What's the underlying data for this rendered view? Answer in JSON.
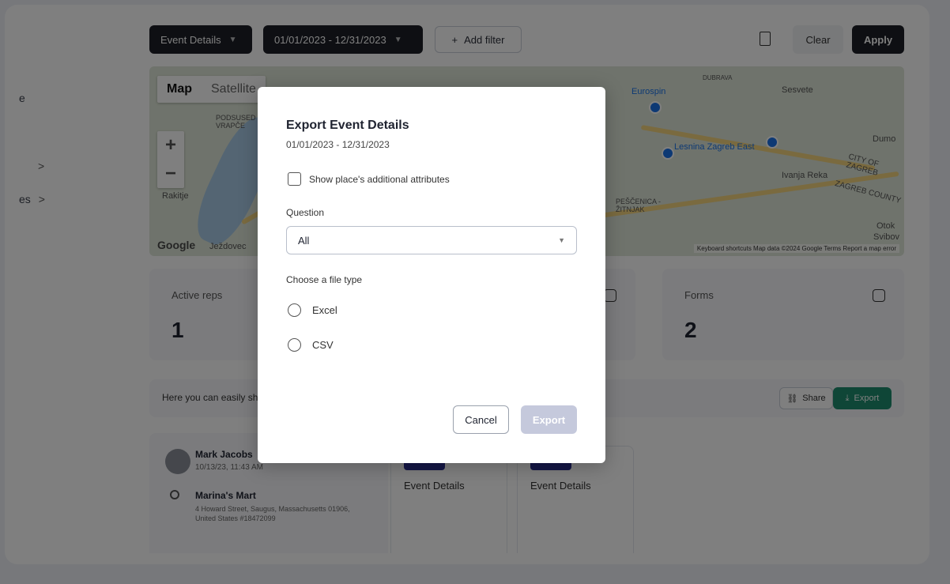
{
  "nav": {
    "items": [
      {
        "label": "e",
        "chevron": ""
      },
      {
        "label": "",
        "chevron": ""
      },
      {
        "label": "",
        "chevron": ">"
      },
      {
        "label": "es",
        "chevron": ">"
      }
    ]
  },
  "topbar": {
    "report_select": "Event Details",
    "date_range": "01/01/2023 - 12/31/2023",
    "add_filter": "Add filter",
    "clear": "Clear",
    "apply": "Apply"
  },
  "map": {
    "tab_map": "Map",
    "tab_satellite": "Satellite",
    "zoom_in": "+",
    "zoom_out": "−",
    "attribution": "Keyboard shortcuts   Map data ©2024 Google   Terms   Report a map error",
    "logo": "Google",
    "labels": [
      "Rakitje",
      "Ježdovec",
      "PODSUSED - VRAPČE",
      "Eurospin",
      "Sesvete",
      "Lesnina Zagreb East",
      "Ivanja Reka",
      "CITY OF ZAGREB",
      "ZAGREB COUNTY",
      "DUBRAVA",
      "PEŠČENICA - ŽITNJAK",
      "Dumo",
      "Otok",
      "Svibov"
    ]
  },
  "stats": [
    {
      "label": "Active reps",
      "value": "1"
    },
    {
      "label": "Forms",
      "value": "2"
    }
  ],
  "sharebar": {
    "text": "Here you can easily sha",
    "share": "Share",
    "export": "Export"
  },
  "activity": {
    "person_name": "Mark Jacobs",
    "timestamp": "10/13/23, 11:43 AM",
    "place_name": "Marina's Mart",
    "address": "4 Howard Street, Saugus, Massachusetts 01906, United States #18472099",
    "event_cards": [
      "Event Details",
      "Event Details"
    ]
  },
  "modal": {
    "title": "Export Event Details",
    "subtitle": "01/01/2023 - 12/31/2023",
    "checkbox_label": "Show place's additional attributes",
    "question_label": "Question",
    "question_value": "All",
    "file_type_label": "Choose a file type",
    "options": [
      "Excel",
      "CSV"
    ],
    "cancel": "Cancel",
    "export": "Export"
  }
}
